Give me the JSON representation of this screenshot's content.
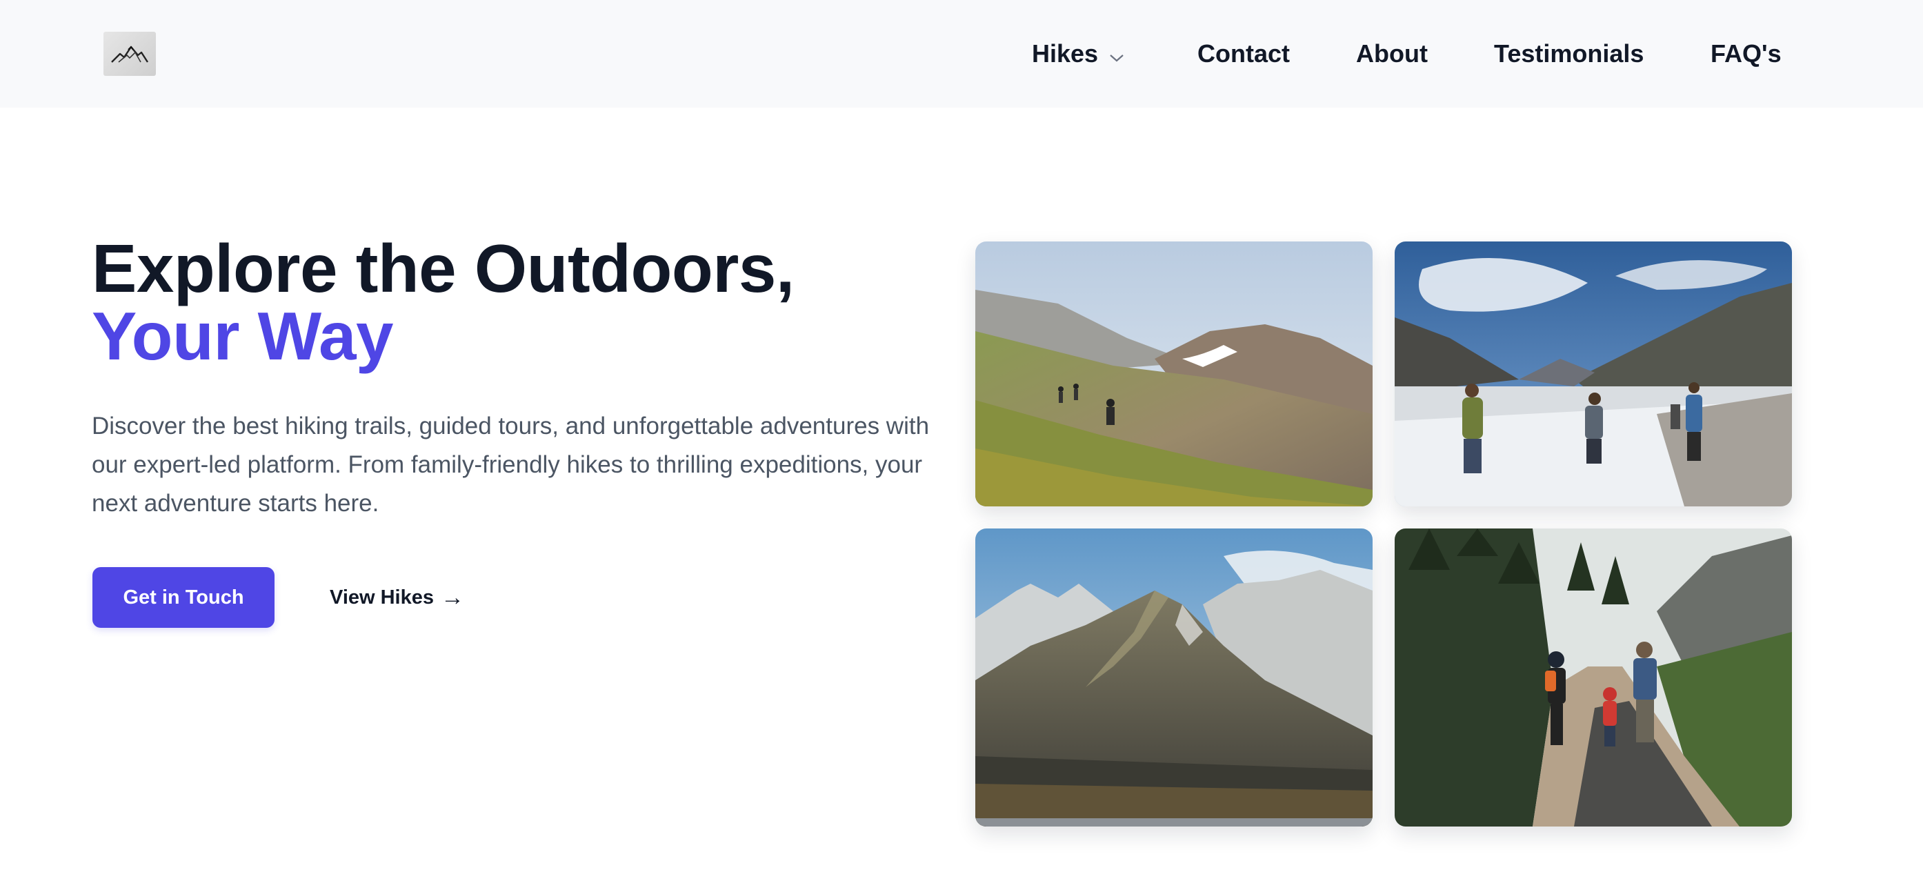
{
  "header": {
    "logo_icon": "mountain-logo-icon",
    "nav": {
      "hikes": "Hikes",
      "contact": "Contact",
      "about": "About",
      "testimonials": "Testimonials",
      "faq": "FAQ's"
    },
    "hikes_dropdown_icon": "chevron-down-icon"
  },
  "hero": {
    "title_line1": "Explore the Outdoors,",
    "title_line2": "Your Way",
    "description": "Discover the best hiking trails, guided tours, and unforgettable adventures with our expert-led platform. From family-friendly hikes to thrilling expeditions, your next adventure starts here.",
    "primary_button": "Get in Touch",
    "secondary_link": "View Hikes",
    "secondary_link_arrow": "→"
  },
  "gallery": {
    "images": [
      "hikers-on-grassy-ridge-photo",
      "group-hiking-snowy-valley-photo",
      "snowy-mountain-peaks-photo",
      "family-walking-forest-trail-photo"
    ]
  },
  "colors": {
    "accent": "#4f46e5",
    "heading": "#111827",
    "body_text": "#4b5563",
    "header_bg": "#f8f9fb"
  }
}
